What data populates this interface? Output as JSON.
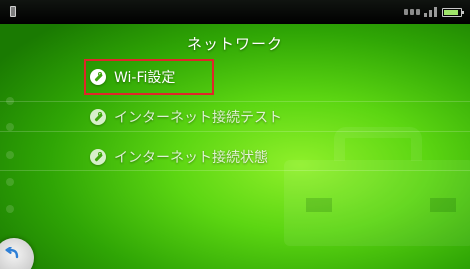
{
  "header": {
    "title": "ネットワーク"
  },
  "menu": {
    "items": [
      {
        "label": "Wi-Fi設定",
        "selected": true
      },
      {
        "label": "インターネット接続テスト",
        "selected": false
      },
      {
        "label": "インターネット接続状態",
        "selected": false
      }
    ]
  },
  "colors": {
    "accent": "#4ccf0f",
    "selection_border": "#e0262a",
    "statusbar": "#000000"
  },
  "icons": {
    "menu_item": "wrench-icon",
    "back": "back-arrow-icon",
    "battery": "battery-icon",
    "signal": "signal-icon"
  }
}
